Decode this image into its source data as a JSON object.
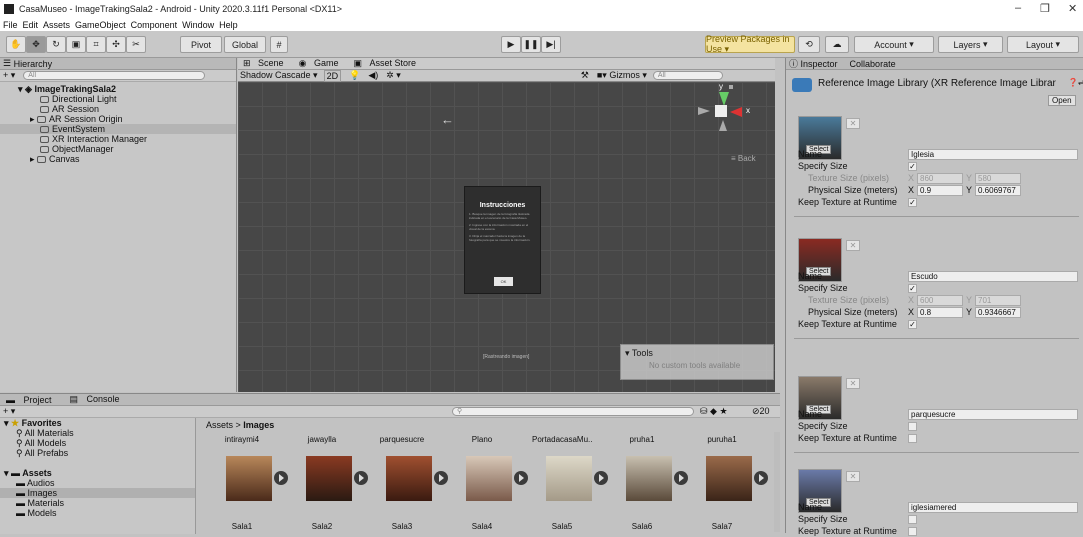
{
  "window": {
    "title": "CasaMuseo - ImageTrakingSala2 - Android - Unity 2020.3.11f1 Personal <DX11>",
    "min": "–",
    "max": "❐",
    "close": "✕"
  },
  "menu": [
    "File",
    "Edit",
    "Assets",
    "GameObject",
    "Component",
    "Window",
    "Help"
  ],
  "toolbar": {
    "pivot": "Pivot",
    "global": "Global",
    "preview": "Preview Packages in Use ▾",
    "account": "Account",
    "layers": "Layers",
    "layout": "Layout"
  },
  "hierarchy": {
    "tab": "Hierarchy",
    "add": "+ ▾",
    "search": "All",
    "root": "ImageTrakingSala2",
    "items": [
      "Directional Light",
      "AR Session",
      "AR Session Origin",
      "EventSystem",
      "XR Interaction Manager",
      "ObjectManager",
      "Canvas"
    ]
  },
  "scene": {
    "tabs": [
      "Scene",
      "Game",
      "Asset Store"
    ],
    "shading": "Shadow Cascade",
    "mode2d": "2D",
    "gizmos": "Gizmos",
    "search": "All",
    "back": "≡ Back",
    "axis_y": "y",
    "axis_x": "x",
    "dialog": {
      "title": "Instrucciones",
      "p1": "1. Busque la imagen de la fotografía ilustrada indicada en el escenario de la Casa Museo.",
      "p2": "2. Ingrese con la información mostrada en el visual de la escena.",
      "p3": "3. Dirija el marcador hacia la imagen de la fotografía para que se muestre la información.",
      "ok": "OK"
    },
    "rastreando": "[Rastreando imagen]",
    "tools_title": "▾ Tools",
    "tools_msg": "No custom tools available"
  },
  "project": {
    "tabs": [
      "Project",
      "Console"
    ],
    "add": "+ ▾",
    "favorites": "Favorites",
    "fav_items": [
      "All Materials",
      "All Models",
      "All Prefabs"
    ],
    "assets": "Assets",
    "asset_items": [
      "Audios",
      "Images",
      "Materials",
      "Models"
    ],
    "path_root": "Assets",
    "path_leaf": "Images",
    "count": "20",
    "row1": [
      "intiraymi4",
      "jawaylla",
      "parquesucre",
      "Plano",
      "PortadacasaMu...",
      "pruha1",
      "puruha1"
    ],
    "row2": [
      "Sala1",
      "Sala2",
      "Sala3",
      "Sala4",
      "Sala5",
      "Sala6",
      "Sala7"
    ],
    "colors": [
      "#7c4a2c",
      "#6b2a1a",
      "#7a3a24",
      "#8a6a5a",
      "#bfb9a8",
      "#7a6a5c",
      "#5a3a2a"
    ]
  },
  "inspector": {
    "tabs": [
      "Inspector",
      "Collaborate"
    ],
    "title": "Reference Image Library (XR Reference Image Librar",
    "open": "Open",
    "select": "Select",
    "x": "✕",
    "lbl_name": "Name",
    "lbl_specify": "Specify Size",
    "lbl_texture": "Texture Size (pixels)",
    "lbl_physical": "Physical Size (meters)",
    "lbl_keep": "Keep Texture at Runtime",
    "X": "X",
    "Y": "Y",
    "check": "✓",
    "entries": [
      {
        "name": "Iglesia",
        "tx": "860",
        "ty": "580",
        "px": "0.9",
        "py": "0.6069767",
        "color": "#4a7a9a"
      },
      {
        "name": "Escudo",
        "tx": "600",
        "ty": "701",
        "px": "0.8",
        "py": "0.9346667",
        "color": "#8a2a22"
      },
      {
        "name": "parquesucre",
        "color": "#8a7a6a"
      },
      {
        "name": "iglesiamered",
        "color": "#6a7aa8"
      }
    ]
  }
}
